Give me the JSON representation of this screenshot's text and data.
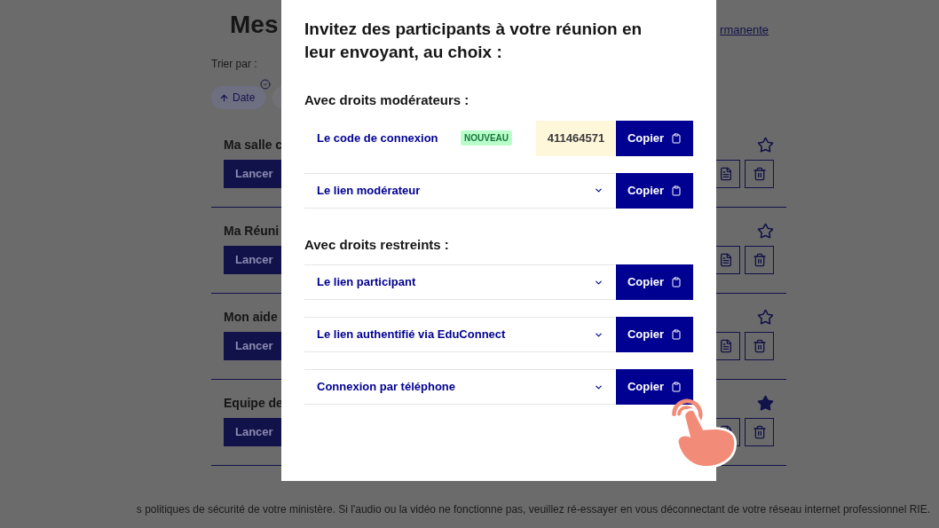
{
  "page": {
    "title": "Mes",
    "link": "rmanente",
    "sort_label": "Trier par :",
    "sort_chips": [
      {
        "label": "Date",
        "selected": true
      },
      {
        "selected": false
      }
    ],
    "rooms": [
      {
        "name": "Ma salle c",
        "button": "Lancer",
        "starred": false
      },
      {
        "name": "Ma Réuni",
        "button": "Lancer",
        "starred": false
      },
      {
        "name": "Mon aide",
        "button": "Lancer",
        "starred": false
      },
      {
        "name": "Equipe de",
        "button": "Lancer",
        "starred": true
      }
    ],
    "footer": "s politiques de sécurité de votre ministère. Si l'audio ou la vidéo ne fonctionne pas, veuillez ré-essayer en vous déconnectant de votre réseau internet professionnel RIE."
  },
  "modal": {
    "title": "Invitez des participants à votre réunion en leur envoyant, au choix :",
    "sections": [
      {
        "heading": "Avec droits modérateurs :",
        "rows": [
          {
            "kind": "code",
            "label": "Le code de connexion",
            "badge": "NOUVEAU",
            "code": "411464571",
            "button": "Copier"
          },
          {
            "kind": "select",
            "label": "Le lien modérateur",
            "button": "Copier"
          }
        ]
      },
      {
        "heading": "Avec droits restreints :",
        "rows": [
          {
            "kind": "select",
            "label": "Le lien participant",
            "button": "Copier"
          },
          {
            "kind": "select",
            "label": "Le lien authentifié via EduConnect",
            "button": "Copier"
          },
          {
            "kind": "select",
            "label": "Connexion par téléphone",
            "button": "Copier"
          }
        ]
      }
    ]
  }
}
